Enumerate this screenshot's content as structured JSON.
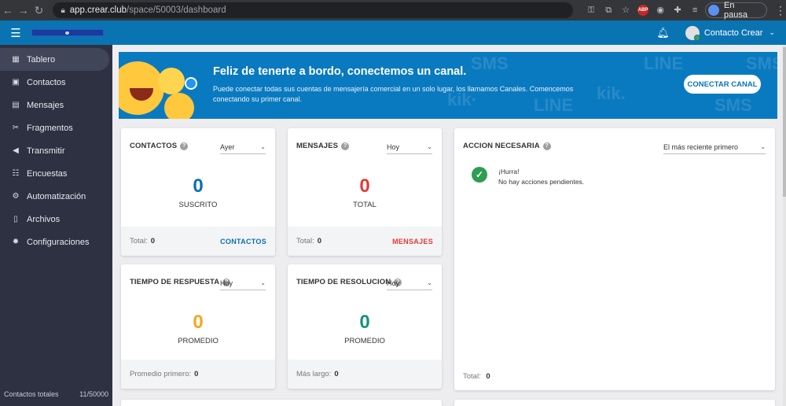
{
  "browser": {
    "url_domain": "app.crear.club",
    "url_path": "/space/50003/dashboard",
    "pause_label": "En pausa",
    "abp_label": "ABP"
  },
  "header": {
    "user_name": "Contacto Crear"
  },
  "sidebar": {
    "items": [
      {
        "label": "Tablero",
        "icon": "dashboard-icon"
      },
      {
        "label": "Contactos",
        "icon": "contacts-icon"
      },
      {
        "label": "Mensajes",
        "icon": "messages-icon"
      },
      {
        "label": "Fragmentos",
        "icon": "scissors-icon"
      },
      {
        "label": "Transmitir",
        "icon": "megaphone-icon"
      },
      {
        "label": "Encuestas",
        "icon": "survey-icon"
      },
      {
        "label": "Automatización",
        "icon": "automation-icon"
      },
      {
        "label": "Archivos",
        "icon": "files-icon"
      },
      {
        "label": "Configuraciones",
        "icon": "gear-icon"
      }
    ],
    "footer_label": "Contactos totales",
    "footer_value": "11/50000"
  },
  "banner": {
    "title": "Feliz de tenerte a bordo, conectemos un canal.",
    "text": "Puede conectar todas sus cuentas de mensajería comercial en un solo lugar, los llamamos Canales. Comencemos conectando su primer canal.",
    "button": "CONECTAR CANAL",
    "pattern_words": [
      "SMS",
      "LINE",
      "kik.",
      "SMS",
      "kik·",
      "LINE",
      "SMS"
    ]
  },
  "cards": {
    "contactos": {
      "title": "CONTACTOS",
      "period": "Ayer",
      "value": "0",
      "label": "SUSCRITO",
      "foot_label": "Total:",
      "foot_value": "0",
      "link": "CONTACTOS",
      "color": "#0a6fb0"
    },
    "mensajes": {
      "title": "MENSAJES",
      "period": "Hoy",
      "value": "0",
      "label": "TOTAL",
      "foot_label": "Total:",
      "foot_value": "0",
      "link": "MENSAJES",
      "color": "#e53935"
    },
    "respuesta": {
      "title": "TIEMPO DE RESPUESTA",
      "period": "Hoy",
      "value": "0",
      "label": "PROMEDIO",
      "foot_label": "Promedio primero:",
      "foot_value": "0",
      "color": "#f5a623"
    },
    "resolucion": {
      "title": "TIEMPO DE RESOLUCION",
      "period": "Hoy",
      "value": "0",
      "label": "PROMEDIO",
      "foot_label": "Más largo:",
      "foot_value": "0",
      "color": "#17927e"
    },
    "accion": {
      "title": "ACCION NECESARIA",
      "sort": "El más reciente primero",
      "item_title": "¡Hurra!",
      "item_text": "No hay acciones pendientes.",
      "foot_label": "Total:",
      "foot_value": "0"
    }
  }
}
